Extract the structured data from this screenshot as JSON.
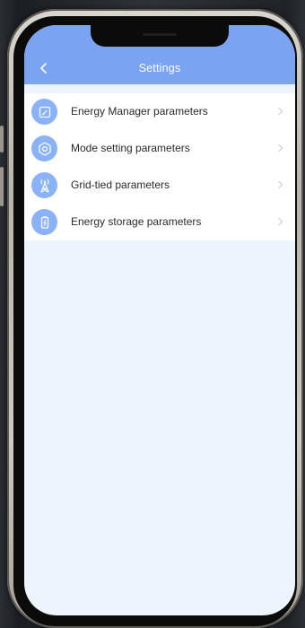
{
  "header": {
    "title": "Settings",
    "back_icon": "chevron-left-icon"
  },
  "menu": {
    "items": [
      {
        "label": "Energy Manager parameters",
        "icon": "energy-manager-icon"
      },
      {
        "label": "Mode setting parameters",
        "icon": "gear-icon"
      },
      {
        "label": "Grid-tied parameters",
        "icon": "transmission-tower-icon"
      },
      {
        "label": "Energy storage parameters",
        "icon": "battery-icon"
      }
    ],
    "chevron_icon": "chevron-right-icon"
  },
  "colors": {
    "header_bg": "#7aa3f2",
    "icon_bg": "#8ab2f6",
    "screen_bg": "#eef4fe",
    "list_bg": "#ffffff",
    "text": "#2a2a2a"
  }
}
